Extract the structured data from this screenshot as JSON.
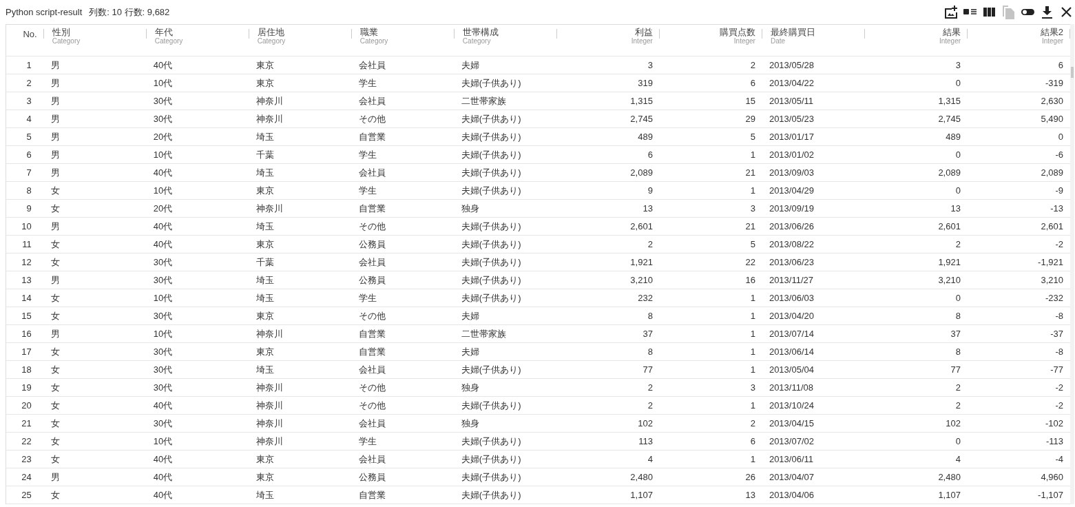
{
  "title": {
    "name": "Python script-result",
    "stats": "列数: 10 行数: 9,682"
  },
  "toolbar": [
    {
      "kind": "add-image",
      "disabled": false
    },
    {
      "kind": "image-list",
      "disabled": false
    },
    {
      "kind": "columns",
      "disabled": false
    },
    {
      "kind": "copy",
      "disabled": true
    },
    {
      "kind": "toggle",
      "disabled": false
    },
    {
      "kind": "download",
      "disabled": false
    },
    {
      "kind": "close",
      "disabled": false
    }
  ],
  "table": {
    "columns": [
      {
        "label": "No.",
        "kind": "number"
      },
      {
        "label": "性別",
        "type": "Category",
        "kind": "text"
      },
      {
        "label": "年代",
        "type": "Category",
        "kind": "text"
      },
      {
        "label": "居住地",
        "type": "Category",
        "kind": "text"
      },
      {
        "label": "職業",
        "type": "Category",
        "kind": "text"
      },
      {
        "label": "世帯構成",
        "type": "Category",
        "kind": "text"
      },
      {
        "label": "利益",
        "type": "Integer",
        "kind": "number"
      },
      {
        "label": "購買点数",
        "type": "Integer",
        "kind": "number"
      },
      {
        "label": "最終購買日",
        "type": "Date",
        "kind": "text"
      },
      {
        "label": "結果",
        "type": "Integer",
        "kind": "number"
      },
      {
        "label": "結果2",
        "type": "Integer",
        "kind": "number"
      }
    ],
    "rows": [
      [
        "1",
        "男",
        "40代",
        "東京",
        "会社員",
        "夫婦",
        "3",
        "2",
        "2013/05/28",
        "3",
        "6"
      ],
      [
        "2",
        "男",
        "10代",
        "東京",
        "学生",
        "夫婦(子供あり)",
        "319",
        "6",
        "2013/04/22",
        "0",
        "-319"
      ],
      [
        "3",
        "男",
        "30代",
        "神奈川",
        "会社員",
        "二世帯家族",
        "1,315",
        "15",
        "2013/05/11",
        "1,315",
        "2,630"
      ],
      [
        "4",
        "男",
        "30代",
        "神奈川",
        "その他",
        "夫婦(子供あり)",
        "2,745",
        "29",
        "2013/05/23",
        "2,745",
        "5,490"
      ],
      [
        "5",
        "男",
        "20代",
        "埼玉",
        "自営業",
        "夫婦(子供あり)",
        "489",
        "5",
        "2013/01/17",
        "489",
        "0"
      ],
      [
        "6",
        "男",
        "10代",
        "千葉",
        "学生",
        "夫婦(子供あり)",
        "6",
        "1",
        "2013/01/02",
        "0",
        "-6"
      ],
      [
        "7",
        "男",
        "40代",
        "埼玉",
        "会社員",
        "夫婦(子供あり)",
        "2,089",
        "21",
        "2013/09/03",
        "2,089",
        "2,089"
      ],
      [
        "8",
        "女",
        "10代",
        "東京",
        "学生",
        "夫婦(子供あり)",
        "9",
        "1",
        "2013/04/29",
        "0",
        "-9"
      ],
      [
        "9",
        "女",
        "20代",
        "神奈川",
        "自営業",
        "独身",
        "13",
        "3",
        "2013/09/19",
        "13",
        "-13"
      ],
      [
        "10",
        "男",
        "40代",
        "埼玉",
        "その他",
        "夫婦(子供あり)",
        "2,601",
        "21",
        "2013/06/26",
        "2,601",
        "2,601"
      ],
      [
        "11",
        "女",
        "40代",
        "東京",
        "公務員",
        "夫婦(子供あり)",
        "2",
        "5",
        "2013/08/22",
        "2",
        "-2"
      ],
      [
        "12",
        "女",
        "30代",
        "千葉",
        "会社員",
        "夫婦(子供あり)",
        "1,921",
        "22",
        "2013/06/23",
        "1,921",
        "-1,921"
      ],
      [
        "13",
        "男",
        "30代",
        "埼玉",
        "公務員",
        "夫婦(子供あり)",
        "3,210",
        "16",
        "2013/11/27",
        "3,210",
        "3,210"
      ],
      [
        "14",
        "女",
        "10代",
        "埼玉",
        "学生",
        "夫婦(子供あり)",
        "232",
        "1",
        "2013/06/03",
        "0",
        "-232"
      ],
      [
        "15",
        "女",
        "30代",
        "東京",
        "その他",
        "夫婦",
        "8",
        "1",
        "2013/04/20",
        "8",
        "-8"
      ],
      [
        "16",
        "男",
        "10代",
        "神奈川",
        "自営業",
        "二世帯家族",
        "37",
        "1",
        "2013/07/14",
        "37",
        "-37"
      ],
      [
        "17",
        "女",
        "30代",
        "東京",
        "自営業",
        "夫婦",
        "8",
        "1",
        "2013/06/14",
        "8",
        "-8"
      ],
      [
        "18",
        "女",
        "30代",
        "埼玉",
        "会社員",
        "夫婦(子供あり)",
        "77",
        "1",
        "2013/05/04",
        "77",
        "-77"
      ],
      [
        "19",
        "女",
        "30代",
        "神奈川",
        "その他",
        "独身",
        "2",
        "3",
        "2013/11/08",
        "2",
        "-2"
      ],
      [
        "20",
        "女",
        "40代",
        "神奈川",
        "その他",
        "夫婦(子供あり)",
        "2",
        "1",
        "2013/10/24",
        "2",
        "-2"
      ],
      [
        "21",
        "女",
        "30代",
        "神奈川",
        "会社員",
        "独身",
        "102",
        "2",
        "2013/04/15",
        "102",
        "-102"
      ],
      [
        "22",
        "女",
        "10代",
        "神奈川",
        "学生",
        "夫婦(子供あり)",
        "113",
        "6",
        "2013/07/02",
        "0",
        "-113"
      ],
      [
        "23",
        "女",
        "40代",
        "東京",
        "会社員",
        "夫婦(子供あり)",
        "4",
        "1",
        "2013/06/11",
        "4",
        "-4"
      ],
      [
        "24",
        "男",
        "40代",
        "東京",
        "公務員",
        "夫婦(子供あり)",
        "2,480",
        "26",
        "2013/04/07",
        "2,480",
        "4,960"
      ],
      [
        "25",
        "女",
        "40代",
        "埼玉",
        "自営業",
        "夫婦(子供あり)",
        "1,107",
        "13",
        "2013/04/06",
        "1,107",
        "-1,107"
      ]
    ]
  }
}
